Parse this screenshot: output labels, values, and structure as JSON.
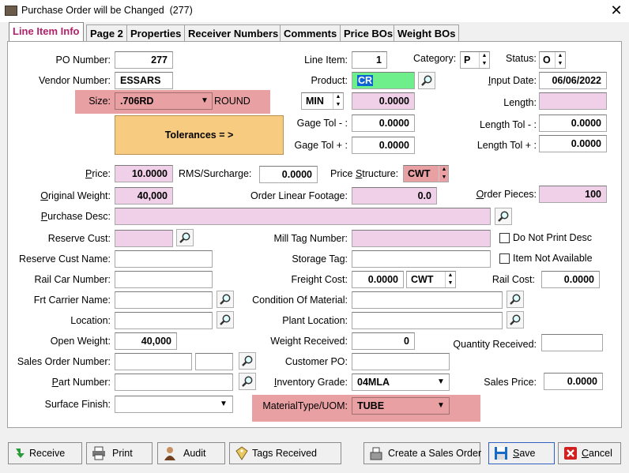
{
  "window": {
    "title": "Purchase Order will be Changed",
    "count": "(277)",
    "close": "✕"
  },
  "tabs": [
    "Line Item Info",
    "Page 2",
    "Properties",
    "Receiver Numbers",
    "Comments",
    "Price BOs",
    "Weight BOs"
  ],
  "left": {
    "po_number": {
      "label": "PO Number:",
      "value": "277"
    },
    "vendor_number": {
      "label": "Vendor Number:",
      "value": "ESSARS"
    },
    "size": {
      "label": "Size:",
      "value": ".706RD",
      "desc": "ROUND"
    },
    "tolerances": "Tolerances = >",
    "price": {
      "label": "Price:",
      "value": "10.0000"
    },
    "original_weight": {
      "label": "Original Weight:",
      "value": "40,000"
    },
    "purchase_desc": {
      "label": "Purchase Desc:",
      "value": ""
    },
    "reserve_cust": {
      "label": "Reserve Cust:",
      "value": ""
    },
    "reserve_cust_name": {
      "label": "Reserve Cust Name:",
      "value": ""
    },
    "rail_car_number": {
      "label": "Rail Car Number:",
      "value": ""
    },
    "frt_carrier_name": {
      "label": "Frt Carrier Name:",
      "value": ""
    },
    "location": {
      "label": "Location:",
      "value": ""
    },
    "open_weight": {
      "label": "Open Weight:",
      "value": "40,000"
    },
    "sales_order_number": {
      "label": "Sales Order Number:",
      "value": ""
    },
    "part_number": {
      "label": "Part Number:",
      "value": ""
    },
    "surface_finish": {
      "label": "Surface Finish:",
      "value": ""
    }
  },
  "mid": {
    "line_item": {
      "label": "Line Item:",
      "value": "1"
    },
    "product": {
      "label": "Product:",
      "value": "CR"
    },
    "min_max": {
      "value": "MIN",
      "amount": "0.0000"
    },
    "gage_tol_minus": {
      "label": "Gage Tol - :",
      "value": "0.0000"
    },
    "gage_tol_plus": {
      "label": "Gage Tol + :",
      "value": "0.0000"
    },
    "rms_surcharge": {
      "label": "RMS/Surcharge:",
      "value": "0.0000"
    },
    "price_structure": {
      "label": "Price Structure:",
      "value": "CWT"
    },
    "order_linear_footage": {
      "label": "Order Linear Footage:",
      "value": "0.0"
    },
    "mill_tag_number": {
      "label": "Mill Tag Number:",
      "value": ""
    },
    "storage_tag": {
      "label": "Storage Tag:",
      "value": ""
    },
    "freight_cost": {
      "label": "Freight Cost:",
      "value": "0.0000",
      "unit": "CWT"
    },
    "condition_of_material": {
      "label": "Condition Of Material:",
      "value": ""
    },
    "plant_location": {
      "label": "Plant Location:",
      "value": ""
    },
    "weight_received": {
      "label": "Weight Received:",
      "value": "0"
    },
    "customer_po": {
      "label": "Customer PO:",
      "value": ""
    },
    "inventory_grade": {
      "label": "Inventory Grade:",
      "value": "04MLA"
    },
    "material_type_uom": {
      "label": "MaterialType/UOM:",
      "value": "TUBE"
    }
  },
  "right": {
    "category": {
      "label": "Category:",
      "value": "P"
    },
    "status": {
      "label": "Status:",
      "value": "O"
    },
    "input_date": {
      "label": "Input Date:",
      "value": "06/06/2022"
    },
    "length": {
      "label": "Length:",
      "value": ""
    },
    "length_tol_minus": {
      "label": "Length Tol - :",
      "value": "0.0000"
    },
    "length_tol_plus": {
      "label": "Length Tol + :",
      "value": "0.0000"
    },
    "order_pieces": {
      "label": "Order Pieces:",
      "value": "100"
    },
    "do_not_print_desc": "Do Not Print Desc",
    "item_not_available": "Item Not Available",
    "rail_cost": {
      "label": "Rail Cost:",
      "value": "0.0000"
    },
    "quantity_received": {
      "label": "Quantity Received:",
      "value": ""
    },
    "sales_price": {
      "label": "Sales Price:",
      "value": "0.0000"
    }
  },
  "buttons": {
    "receive": "Receive",
    "print": "Print",
    "audit": "Audit",
    "tags_received": "Tags Received",
    "create_sales_order": "Create a Sales Order",
    "save": "Save",
    "cancel": "Cancel"
  },
  "colors": {
    "pink": "#f0d0e8",
    "green": "#6fef8c",
    "salmon": "#e8a0a3",
    "tolerance": "#f8cc80",
    "active_tab": "#b0226a",
    "selection": "#0a64d2"
  }
}
